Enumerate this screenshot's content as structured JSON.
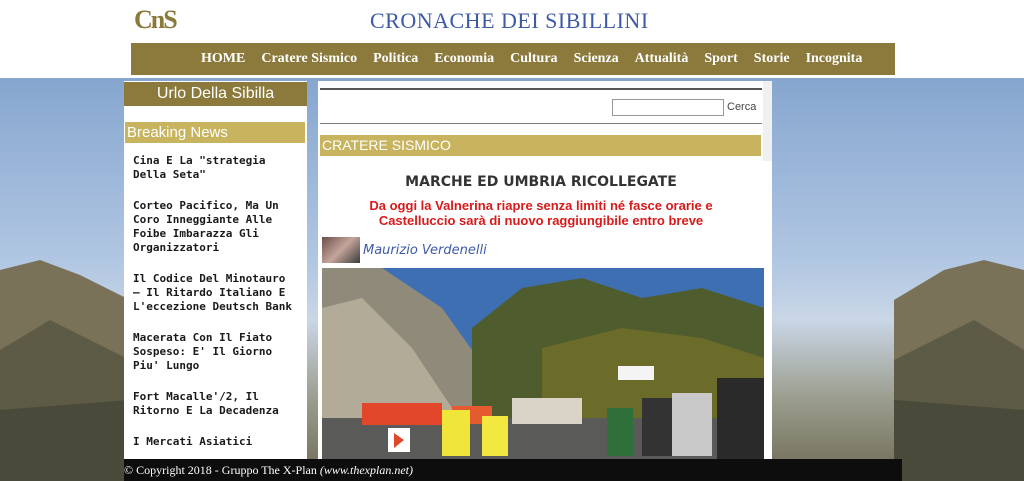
{
  "header": {
    "logo_text": "CnS",
    "site_title": "CRONACHE DEI SIBILLINI"
  },
  "nav": {
    "items": [
      "HOME",
      "Cratere Sismico",
      "Politica",
      "Economia",
      "Cultura",
      "Scienza",
      "Attualità",
      "Sport",
      "Storie",
      "Incognita"
    ]
  },
  "sidebar": {
    "urlo_title": "Urlo Della Sibilla",
    "breaking_title": "Breaking News",
    "news": [
      "Cina E La \"strategia Della Seta\"",
      "Corteo Pacifico, Ma Un Coro Inneggiante Alle Foibe Imbarazza Gli Organizzatori",
      "Il Codice Del Minotauro – Il Ritardo Italiano E L'eccezione Deutsch Bank",
      "Macerata Con Il Fiato Sospeso: E' Il Giorno Piu' Lungo",
      "Fort Macalle'/2, Il Ritorno E La Decadenza",
      "I Mercati Asiatici"
    ]
  },
  "search": {
    "value": "",
    "button_label": "Cerca"
  },
  "article": {
    "section": "CRATERE SISMICO",
    "headline": "MARCHE ED UMBRIA RICOLLEGATE",
    "subhead": "Da oggi la Valnerina riapre senza limiti né fasce orarie e Castelluccio sarà di nuovo raggiungibile entro breve",
    "author": "Maurizio Verdenelli"
  },
  "footer": {
    "copyright": "© Copyright 2018 - Gruppo The X-Plan ",
    "site": "(www.thexplan.net)"
  },
  "colors": {
    "nav_bg": "#8b7a3b",
    "section_bg": "#c8b35e",
    "title_blue": "#3e59a8",
    "subhead_red": "#d81a1a"
  }
}
